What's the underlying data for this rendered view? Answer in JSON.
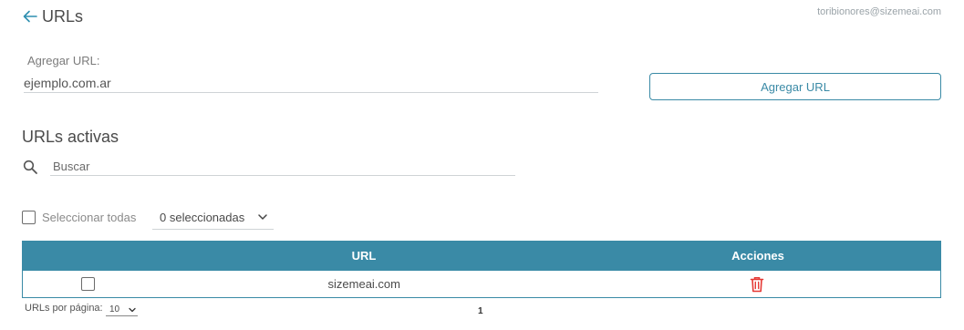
{
  "header": {
    "title": "URLs",
    "user_email": "toribionores@sizemeai.com"
  },
  "add_url": {
    "label": "Agregar URL:",
    "input_value": "ejemplo.com.ar",
    "button_label": "Agregar URL"
  },
  "active_urls": {
    "title": "URLs activas",
    "search_placeholder": "Buscar",
    "select_all_label": "Seleccionar todas",
    "selected_count_label": "0 seleccionadas"
  },
  "table": {
    "columns": [
      "",
      "URL",
      "Acciones"
    ],
    "rows": [
      {
        "url": "sizemeai.com"
      }
    ]
  },
  "pagination": {
    "per_page_label": "URLs por página:",
    "per_page_value": "10",
    "current_page": "1"
  },
  "colors": {
    "accent": "#3a8aa6",
    "delete": "#e53935"
  }
}
